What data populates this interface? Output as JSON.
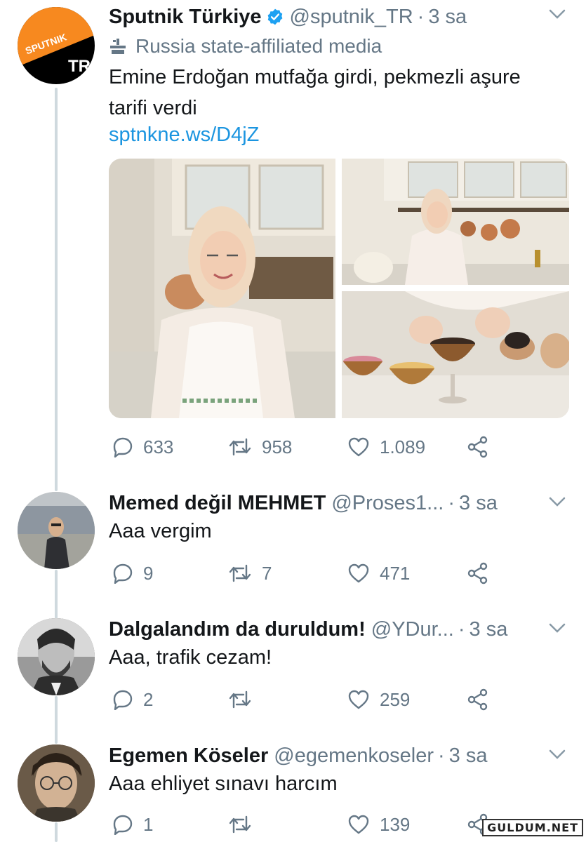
{
  "main_tweet": {
    "display_name": "Sputnik Türkiye",
    "handle": "@sputnik_TR",
    "separator": "·",
    "time": "3 sa",
    "affiliation": "Russia state-affiliated media",
    "text_line1": "Emine Erdoğan mutfağa girdi, pekmezli aşure",
    "text_line2": "tarifi verdi",
    "link": "sptnkne.ws/D4jZ",
    "avatar_logo_text": "SPUTNIK",
    "avatar_logo_sub": "TR",
    "stats": {
      "replies": "633",
      "retweets": "958",
      "likes": "1.089"
    }
  },
  "replies": [
    {
      "display_name": "Memed değil MEHMET",
      "handle": "@Proses1...",
      "separator": "·",
      "time": "3 sa",
      "text": "Aaa vergim",
      "stats": {
        "replies": "9",
        "retweets": "7",
        "likes": "471"
      }
    },
    {
      "display_name": "Dalgalandım da duruldum!",
      "handle": "@YDur...",
      "separator": "·",
      "time": "3 sa",
      "text": "Aaa, trafik cezam!",
      "stats": {
        "replies": "2",
        "retweets": "",
        "likes": "259"
      }
    },
    {
      "display_name": "Egemen Köseler",
      "handle": "@egemenkoseler",
      "separator": "·",
      "time": "3 sa",
      "text": "Aaa ehliyet sınavı harcım",
      "stats": {
        "replies": "1",
        "retweets": "",
        "likes": "139"
      }
    }
  ],
  "watermark": "GULDUM.NET",
  "colors": {
    "link": "#1b95e0",
    "secondary": "#657786",
    "verified": "#1da1f2",
    "thread_line": "#cfd9de"
  },
  "icons": [
    "verified-badge-icon",
    "chevron-down-icon",
    "state-media-icon",
    "reply-icon",
    "retweet-icon",
    "like-icon",
    "share-icon"
  ]
}
